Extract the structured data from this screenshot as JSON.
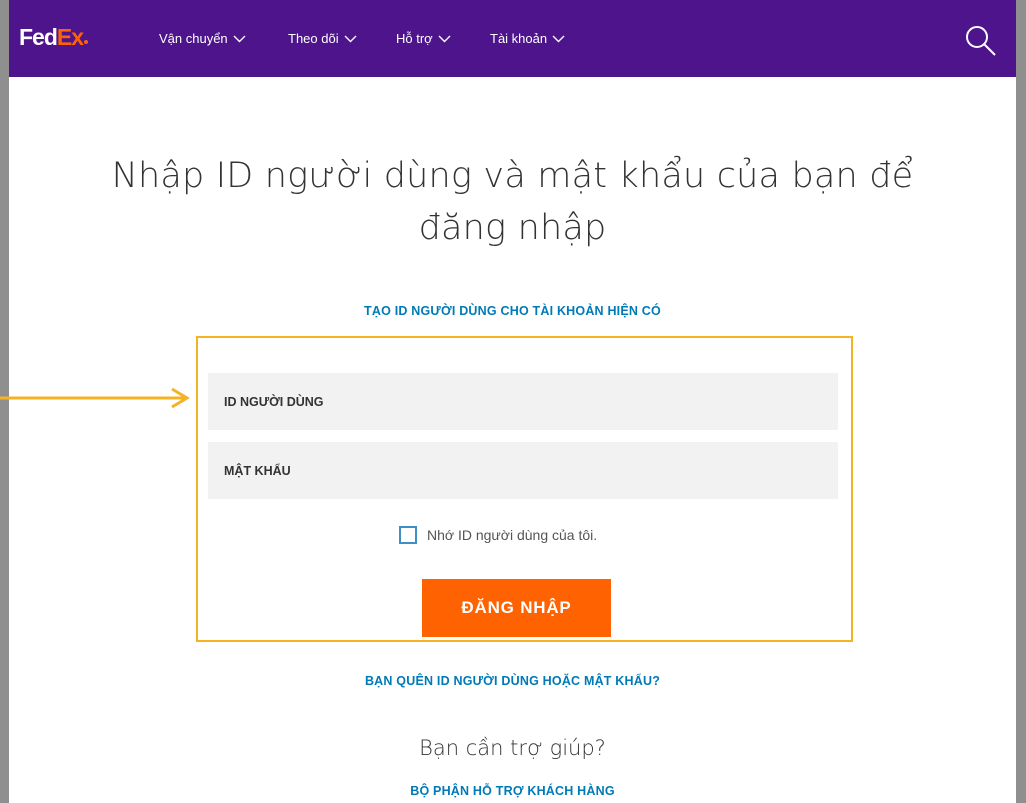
{
  "header": {
    "logo_fed": "Fed",
    "logo_ex": "Ex",
    "nav": [
      {
        "label": "Vận chuyển"
      },
      {
        "label": "Theo dõi"
      },
      {
        "label": "Hỗ trợ"
      },
      {
        "label": "Tài khoản"
      }
    ]
  },
  "main": {
    "heading_line1": "Nhập ID người dùng và mật khẩu của bạn để",
    "heading_line2": "đăng nhập",
    "create_link": "TẠO ID NGƯỜI DÙNG CHO TÀI KHOẢN HIỆN CÓ",
    "userid_label": "ID NGƯỜI DÙNG",
    "password_label": "MẬT KHẨU",
    "remember_label": "Nhớ ID người dùng của tôi.",
    "login_button": "ĐĂNG NHẬP",
    "forgot_link": "BẠN QUÊN ID NGƯỜI DÙNG HOẶC MẬT KHẨU?",
    "help_heading": "Bạn cần trợ giúp?",
    "support_link": "BỘ PHẬN HỖ TRỢ KHÁCH HÀNG"
  },
  "colors": {
    "brand_purple": "#4d148c",
    "brand_orange": "#ff6200",
    "link_blue": "#007ab7",
    "highlight": "#f5b324"
  },
  "icons": {
    "search": "search-icon",
    "chevron": "chevron-down-icon",
    "annotation": "arrow-right-icon"
  }
}
